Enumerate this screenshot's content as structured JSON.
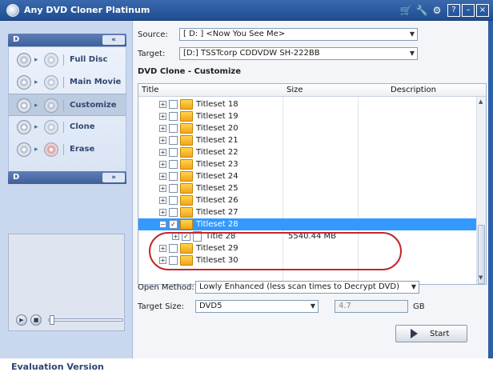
{
  "app": {
    "title": "Any DVD Cloner Platinum"
  },
  "titlebar_icons": [
    "cart-icon",
    "wrench-icon",
    "gear-icon",
    "help-icon",
    "minimize-icon",
    "close-icon"
  ],
  "titlebar_glyphs": {
    "help": "?",
    "minimize": "–",
    "close": "×"
  },
  "sidebar": {
    "drive_header": "D",
    "collapse_glyph": "«",
    "modes": [
      {
        "label": "Full Disc",
        "icon": "disc-icon"
      },
      {
        "label": "Main Movie",
        "icon": "star-disc-icon"
      },
      {
        "label": "Customize",
        "icon": "customize-disc-icon",
        "selected": true
      },
      {
        "label": "Clone",
        "icon": "clone-disc-icon"
      },
      {
        "label": "Erase",
        "icon": "erase-disc-icon"
      }
    ],
    "second_header": "D",
    "expand_glyph": "»",
    "evaluation_label": "Evaluation Version"
  },
  "main": {
    "source_label": "Source:",
    "source_value": "[ D: ]  <Now You See Me>",
    "target_label": "Target:",
    "target_value": "[D:] TSSTcorp CDDVDW SH-222BB",
    "section_title": "DVD Clone - Customize",
    "table": {
      "columns": [
        "Title",
        "Size",
        "Description"
      ],
      "rows": [
        {
          "name": "Titleset 18",
          "size": ""
        },
        {
          "name": "Titleset 19",
          "size": ""
        },
        {
          "name": "Titleset 20",
          "size": ""
        },
        {
          "name": "Titleset 21",
          "size": ""
        },
        {
          "name": "Titleset 22",
          "size": ""
        },
        {
          "name": "Titleset 23",
          "size": ""
        },
        {
          "name": "Titleset 24",
          "size": ""
        },
        {
          "name": "Titleset 25",
          "size": ""
        },
        {
          "name": "Titleset 26",
          "size": ""
        },
        {
          "name": "Titleset 27",
          "size": ""
        },
        {
          "name": "Titleset 28",
          "size": "",
          "selected": true,
          "checked": true,
          "expanded": true
        },
        {
          "name": "Title 28",
          "size": "5540.44 MB",
          "child": true,
          "checked": true
        },
        {
          "name": "Titleset 29",
          "size": ""
        },
        {
          "name": "Titleset 30",
          "size": ""
        }
      ]
    },
    "open_method_label": "Open Method:",
    "open_method_value": "Lowly Enhanced  (less scan times to Decrypt DVD)",
    "target_size_label": "Target Size:",
    "target_size_value": "DVD5",
    "target_size_gb": "4.7",
    "gb_unit": "GB",
    "start_label": "Start"
  },
  "colors": {
    "titlebar": "#2f5fa6",
    "selection": "#3399ff",
    "highlight_ring": "#c0282b",
    "sidebar_bg": "#c9d8ee"
  }
}
